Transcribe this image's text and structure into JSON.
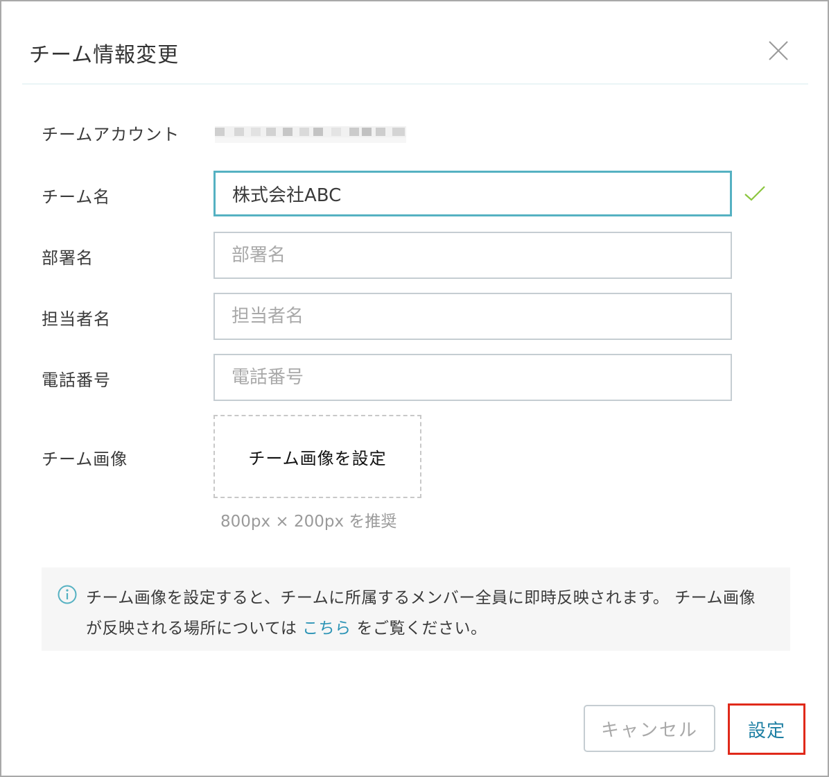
{
  "dialog": {
    "title": "チーム情報変更",
    "close_icon": "close-icon"
  },
  "form": {
    "account": {
      "label": "チームアカウント",
      "value_masked": true
    },
    "team_name": {
      "label": "チーム名",
      "value": "株式会社ABC",
      "valid_icon": "check-icon"
    },
    "department": {
      "label": "部署名",
      "placeholder": "部署名",
      "value": ""
    },
    "contact": {
      "label": "担当者名",
      "placeholder": "担当者名",
      "value": ""
    },
    "phone": {
      "label": "電話番号",
      "placeholder": "電話番号",
      "value": ""
    },
    "image": {
      "label": "チーム画像",
      "button_label": "チーム画像を設定",
      "hint": "800px × 200px を推奨"
    }
  },
  "notice": {
    "icon": "info-icon",
    "text_before": "チーム画像を設定すると、チームに所属するメンバー全員に即時反映されます。 チーム画像が反映される場所については ",
    "link_text": "こちら",
    "text_after": " をご覧ください。"
  },
  "footer": {
    "cancel_label": "キャンセル",
    "submit_label": "設定"
  },
  "colors": {
    "accent": "#55b1c2",
    "link": "#2a93b5",
    "check": "#8cc63f",
    "highlight_border": "#e0291a"
  }
}
